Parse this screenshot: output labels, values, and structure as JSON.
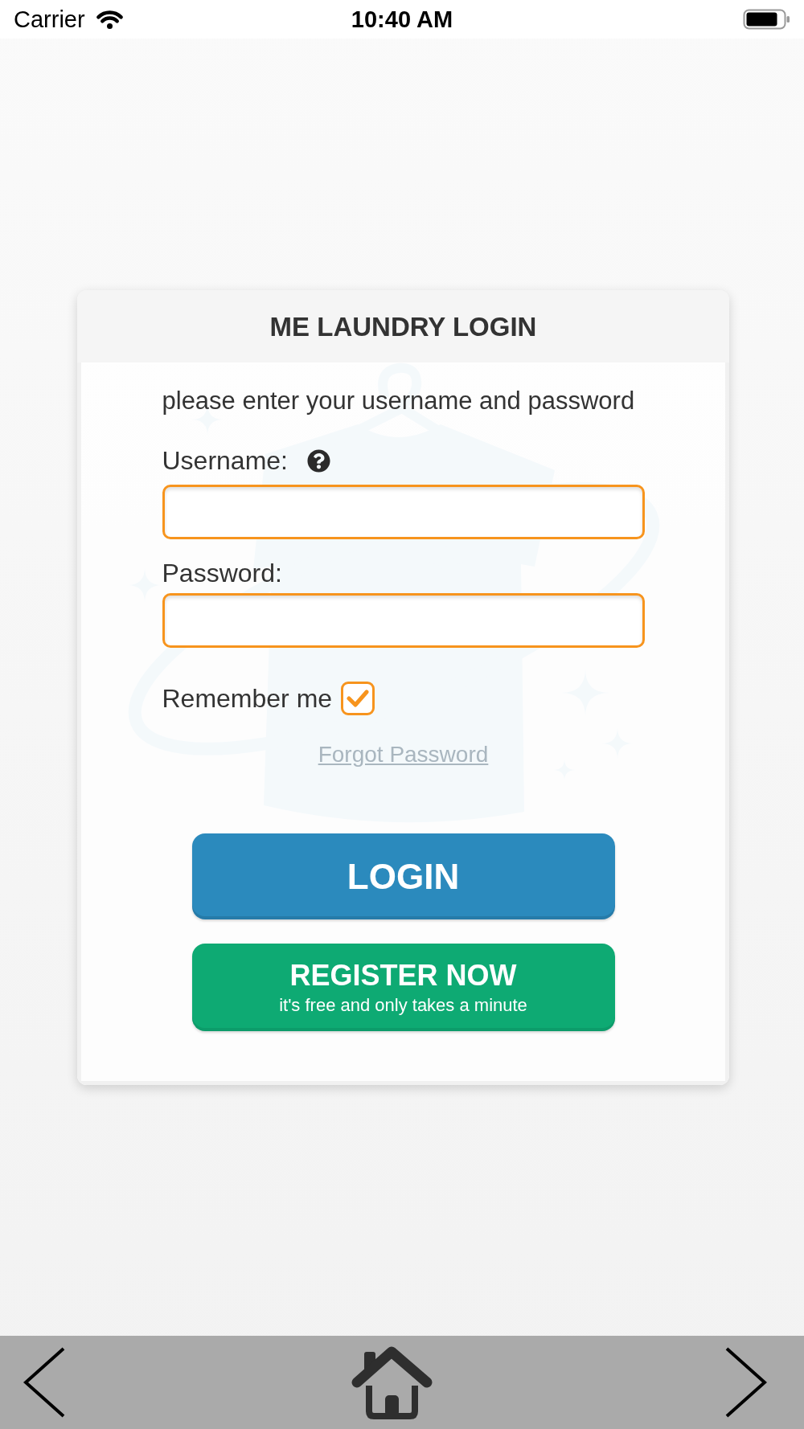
{
  "status_bar": {
    "carrier": "Carrier",
    "time": "10:40 AM"
  },
  "login_card": {
    "title": "ME LAUNDRY LOGIN",
    "instruction": "please enter your username and password",
    "fields": [
      {
        "label": "Username:",
        "help": true
      },
      {
        "label": "Password:",
        "help": false
      }
    ],
    "remember_me": {
      "label": "Remember me",
      "checked": true
    },
    "forgot_link": "Forgot Password",
    "login_button": "LOGIN",
    "register_button": {
      "label": "REGISTER NOW",
      "subtitle": "it's free and only takes a minute"
    }
  }
}
